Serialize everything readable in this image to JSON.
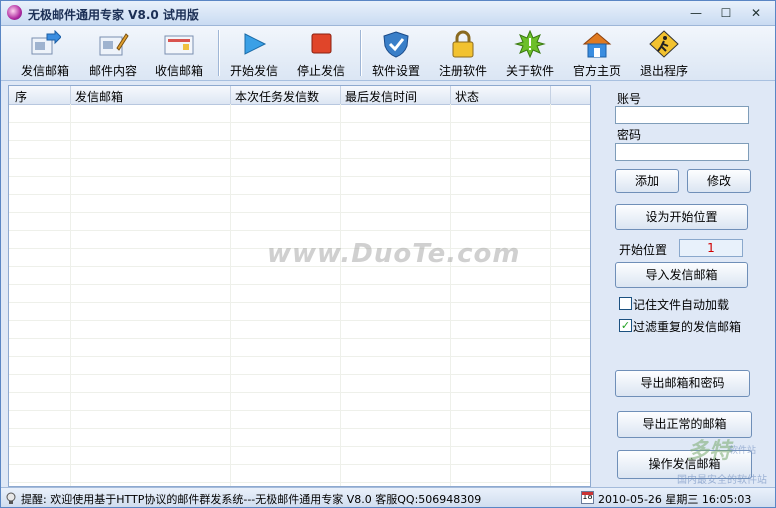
{
  "window": {
    "title": "无极邮件通用专家 V8.0 试用版",
    "min": "—",
    "max": "☐",
    "close": "✕"
  },
  "toolbar": [
    {
      "label": "发信邮箱",
      "icon": "sender-mailbox-icon"
    },
    {
      "label": "邮件内容",
      "icon": "mail-content-icon"
    },
    {
      "label": "收信邮箱",
      "icon": "receiver-mailbox-icon"
    },
    {
      "label": "开始发信",
      "icon": "play-icon"
    },
    {
      "label": "停止发信",
      "icon": "stop-icon"
    },
    {
      "label": "软件设置",
      "icon": "shield-icon"
    },
    {
      "label": "注册软件",
      "icon": "lock-icon"
    },
    {
      "label": "关于软件",
      "icon": "sun-icon"
    },
    {
      "label": "官方主页",
      "icon": "home-icon"
    },
    {
      "label": "退出程序",
      "icon": "exit-sign-icon"
    }
  ],
  "table": {
    "columns": [
      "序",
      "发信邮箱",
      "本次任务发信数",
      "最后发信时间",
      "状态"
    ],
    "rows": []
  },
  "panel": {
    "account_label": "账号",
    "account_value": "",
    "password_label": "密码",
    "password_value": "",
    "add_button": "添加",
    "modify_button": "修改",
    "set_start_button": "设为开始位置",
    "start_pos_label": "开始位置",
    "start_pos_value": "1",
    "import_button": "导入发信邮箱",
    "remember_file_label": "记住文件自动加载",
    "remember_file_checked": false,
    "filter_dup_label": "过滤重复的发信邮箱",
    "filter_dup_checked": true,
    "filter_dup_check_glyph": "✓",
    "export_pwd_button": "导出邮箱和密码",
    "export_normal_button": "导出正常的邮箱",
    "operate_button": "操作发信邮箱"
  },
  "watermark": {
    "main": "www.DuoTe.com",
    "brand": "多特",
    "brand_small": "软件站",
    "tagline": "国内最安全的软件站"
  },
  "statusbar": {
    "message": "提醒: 欢迎使用基于HTTP协议的邮件群发系统---无极邮件通用专家 V8.0 客服QQ:506948309",
    "calendar_day": "18",
    "datetime": "2010-05-26 星期三 16:05:03"
  },
  "colors": {
    "window_bg": "#dfe8f6",
    "start_pos_value": "#d00000",
    "checkmark": "#21a121"
  }
}
